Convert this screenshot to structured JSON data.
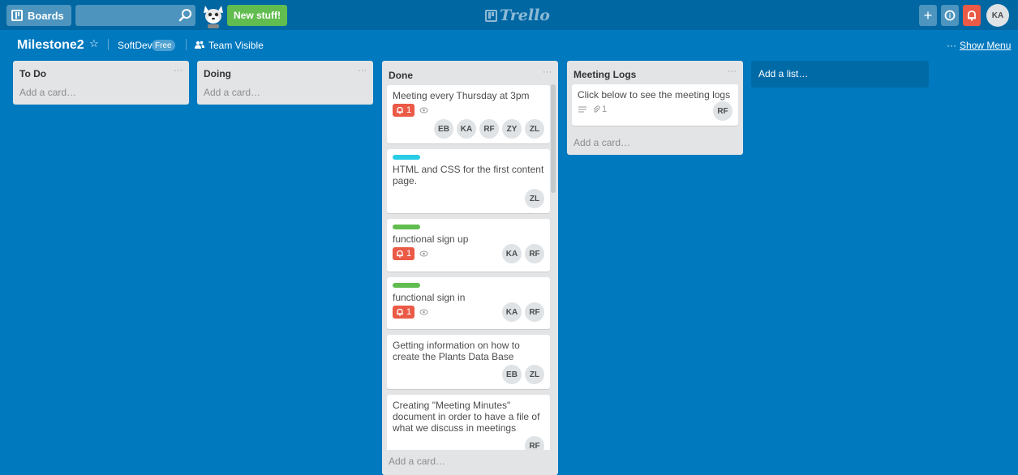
{
  "header": {
    "boards_label": "Boards",
    "search_value": "",
    "new_stuff_label": "New stuff!",
    "logo_text": "Trello",
    "add_label": "+",
    "info_label": "i",
    "avatar_initials": "KA",
    "icons": [
      "boards-icon",
      "search-icon",
      "mascot-icon",
      "trello-logo-icon",
      "add-icon",
      "info-icon",
      "bell-icon"
    ]
  },
  "board": {
    "title": "Milestone2",
    "star": "☆",
    "team": "SoftDev",
    "team_badge": "Free",
    "visibility": "Team Visible",
    "show_menu_dots": "···",
    "show_menu": "Show Menu"
  },
  "lists": [
    {
      "title": "To Do",
      "menu": "···",
      "add_card": "Add a card…"
    },
    {
      "title": "Doing",
      "menu": "···",
      "add_card": "Add a card…"
    },
    {
      "title": "Done",
      "menu": "···",
      "add_card": "Add a card…",
      "cards": [
        {
          "title": "Meeting every Thursday at 3pm",
          "due_count": "1",
          "members": [
            "EB",
            "KA",
            "RF",
            "ZY",
            "ZL"
          ]
        },
        {
          "title": "HTML and CSS for the first content page.",
          "label_color": "#29cce5",
          "members": [
            "ZL"
          ]
        },
        {
          "title": "functional sign up",
          "label_color": "#61bd4f",
          "due_count": "1",
          "members": [
            "KA",
            "RF"
          ]
        },
        {
          "title": "functional sign in",
          "label_color": "#61bd4f",
          "due_count": "1",
          "members": [
            "KA",
            "RF"
          ]
        },
        {
          "title": "Getting information on how to create the Plants Data Base",
          "members": [
            "EB",
            "ZL"
          ]
        },
        {
          "title": "Creating \"Meeting Minutes\" document in order to have a file of what we discuss in meetings",
          "members": [
            "RF"
          ]
        }
      ]
    },
    {
      "title": "Meeting Logs",
      "menu": "···",
      "add_card": "Add a card…",
      "cards": [
        {
          "title": "Click below to see the meeting logs",
          "attachments": "1",
          "members": [
            "RF"
          ]
        }
      ]
    }
  ],
  "add_list": "Add a list…",
  "colors": {
    "board_bg": "#0079bf",
    "header_bg": "#0067a3",
    "green": "#61bd4f",
    "red": "#eb5a46",
    "cyan": "#29cce5"
  }
}
